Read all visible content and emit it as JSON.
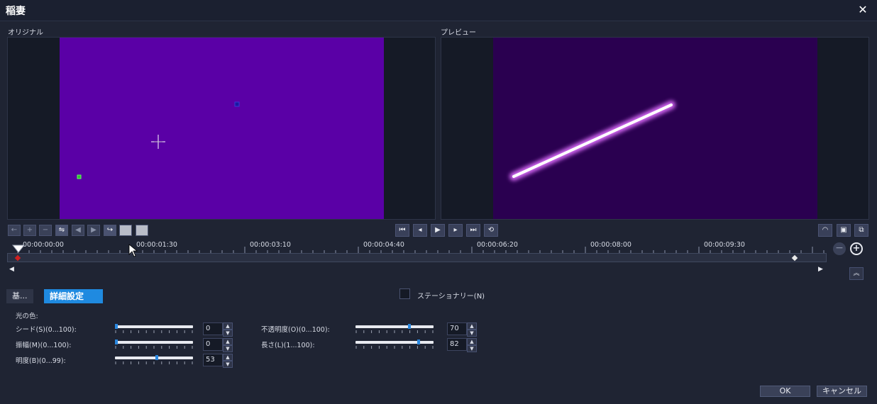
{
  "window": {
    "title": "稲妻",
    "close_glyph": "✕"
  },
  "panels": {
    "original_label": "オリジナル",
    "preview_label": "プレビュー"
  },
  "colors": {
    "original_frame": "#5a00a6",
    "preview_frame": "#2a0050",
    "accent": "#1f8ae0"
  },
  "timeline": {
    "ticks": [
      "00:00:00:00",
      "00:00:01:30",
      "00:00:03:10",
      "00:00:04:40",
      "00:00:06:20",
      "00:00:08:00",
      "00:00:09:30"
    ]
  },
  "tabs": {
    "basic": "基...",
    "advanced": "詳細設定"
  },
  "stationary": {
    "label": "ステーショナリー(N)",
    "checked": false
  },
  "section_label": "光の色:",
  "sliders": {
    "seed": {
      "label": "シード(S)(0...100):",
      "value": "0",
      "percent": 0
    },
    "amplitude": {
      "label": "振幅(M)(0...100):",
      "value": "0",
      "percent": 0
    },
    "brightness": {
      "label": "明度(B)(0...99):",
      "value": "53",
      "percent": 53.5
    },
    "opacity": {
      "label": "不透明度(O)(0...100):",
      "value": "70",
      "percent": 70
    },
    "length": {
      "label": "長さ(L)(1...100):",
      "value": "82",
      "percent": 81.8
    }
  },
  "buttons": {
    "ok": "OK",
    "cancel": "キャンセル"
  }
}
